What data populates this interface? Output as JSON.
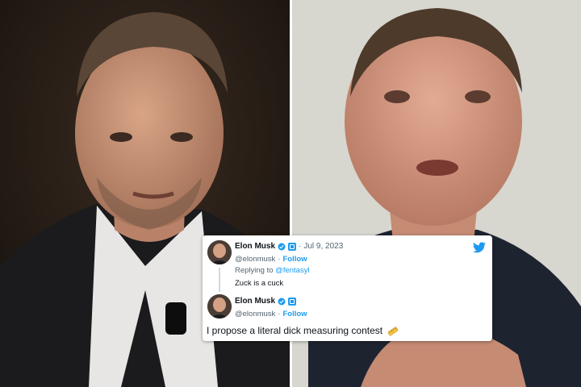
{
  "tweets": [
    {
      "name": "Elon Musk",
      "handle": "@elonmusk",
      "follow_label": "Follow",
      "sep": "·",
      "date": "Jul 9, 2023",
      "date_prefix": "·",
      "replying_label": "Replying to",
      "replying_to": "@fentasyl",
      "text": "Zuck is a cuck"
    },
    {
      "name": "Elon Musk",
      "handle": "@elonmusk",
      "follow_label": "Follow",
      "sep": "·",
      "text": "I propose a literal dick measuring contest"
    }
  ],
  "colors": {
    "twitter_blue": "#1d9bf0",
    "name_text": "#0f1419",
    "secondary_text": "#536471"
  },
  "icons": {
    "bird": "twitter-bird-icon",
    "verified": "verified-icon",
    "emoji": "straight-ruler-emoji-icon"
  }
}
